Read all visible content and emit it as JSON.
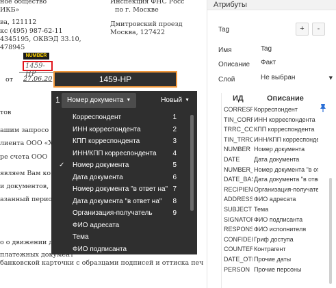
{
  "document": {
    "lines": [
      "ное общество",
      "ИКБ»",
      "ва, 121112",
      "кс (495) 987-62-11",
      "4345195, ОКВЭД 33.10,",
      "478945",
      "от",
      "27.06.20",
      "тов",
      "ашим  запросо",
      "лиента ООО «Х",
      "ре счета ООО",
      "являем  Вам  ко",
      "и  документов,",
      "азанный  перио",
      "о о движении д",
      "платежных документ",
      "банковской карточки с образцами подписей и оттиска печати на"
    ],
    "addressee_lines": [
      "Инспекция ФНС Росс",
      "по г. Москве",
      "Дмитровский проезд",
      "Москва, 127422"
    ],
    "number_tag": "NUMBER",
    "number_field_value": "1459-НР"
  },
  "number_bar": {
    "value": "1459-НР"
  },
  "toolbar": {
    "left_digit": "1",
    "field_label": "Номер документа",
    "status_label": "Новый"
  },
  "field_menu": {
    "items": [
      {
        "label": "Корреспондент",
        "num": "1",
        "checked": false
      },
      {
        "label": "ИНН корреспондента",
        "num": "2",
        "checked": false
      },
      {
        "label": "КПП корреспондента",
        "num": "3",
        "checked": false
      },
      {
        "label": "ИНН/КПП корреспондента",
        "num": "4",
        "checked": false
      },
      {
        "label": "Номер документа",
        "num": "5",
        "checked": true
      },
      {
        "label": "Дата документа",
        "num": "6",
        "checked": false
      },
      {
        "label": "Номер документа \"в ответ на\"",
        "num": "7",
        "checked": false
      },
      {
        "label": "Дата документа \"в ответ на\"",
        "num": "8",
        "checked": false
      },
      {
        "label": "Организация-получатель",
        "num": "9",
        "checked": false
      },
      {
        "label": "ФИО адресата",
        "num": "",
        "checked": false
      },
      {
        "label": "Тема",
        "num": "",
        "checked": false
      },
      {
        "label": "ФИО подписанта",
        "num": "",
        "checked": false
      }
    ]
  },
  "attributes": {
    "title": "Атрибуты",
    "tag_label": "Tag",
    "add_button": "+",
    "remove_button": "-",
    "name_label": "Имя",
    "name_value": "Tag",
    "description_label": "Описание",
    "description_value": "Факт",
    "layer_label": "Слой",
    "layer_value": "Не выбран",
    "table": {
      "headers": [
        "ИД",
        "Описание"
      ],
      "rows": [
        [
          "CORRESPONDENT",
          "Корреспондент"
        ],
        [
          "TIN_CORRESPONDENT",
          "ИНН корреспондента"
        ],
        [
          "TRRC_CORRESPONDENT",
          "КПП корреспондента"
        ],
        [
          "TIN_TRRC",
          "ИНН/КПП корреспондента"
        ],
        [
          "NUMBER",
          "Номер документа"
        ],
        [
          "DATE",
          "Дата документа"
        ],
        [
          "NUMBER_BASE",
          "Номер документа \"в ответ на\""
        ],
        [
          "DATE_BASE",
          "Дата документа \"в ответ на\""
        ],
        [
          "RECIPIENT",
          "Организация-получатель"
        ],
        [
          "ADDRESSEE",
          "ФИО адресата"
        ],
        [
          "SUBJECT",
          "Тема"
        ],
        [
          "SIGNATORY",
          "ФИО подписанта"
        ],
        [
          "RESPONSIBLE",
          "ФИО исполнителя"
        ],
        [
          "CONFIDENTIAL",
          "Гриф доступа"
        ],
        [
          "COUNTERPARTY",
          "Контрагент"
        ],
        [
          "DATE_OTHER",
          "Прочие даты"
        ],
        [
          "PERSON",
          "Прочие персоны"
        ]
      ]
    }
  },
  "colors": {
    "menu_bg": "#2f2f2f",
    "number_highlight": "#e0141b",
    "number_bar_border": "#f0973a",
    "pin": "#2b6fd6"
  },
  "icons": {
    "checkmark": "check-icon",
    "pin": "pin-icon",
    "dropdown": "caret-down-icon"
  }
}
